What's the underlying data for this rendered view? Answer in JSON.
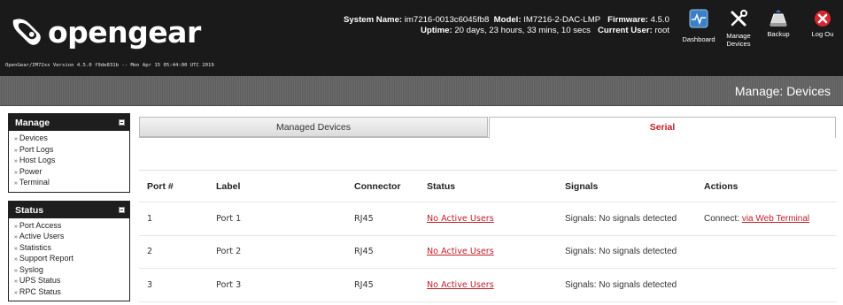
{
  "header": {
    "logo_text": "opengear",
    "version_line": "OpenGear/IM72xx Version 4.5.0 f9de831b -- Mon Apr 15 05:44:00 UTC 2019",
    "system_name_label": "System Name:",
    "system_name": "im7216-0013c6045fb8",
    "model_label": "Model:",
    "model": "IM7216-2-DAC-LMP",
    "firmware_label": "Firmware:",
    "firmware": "4.5.0",
    "uptime_label": "Uptime:",
    "uptime": "20 days, 23 hours, 33 mins, 10 secs",
    "current_user_label": "Current User:",
    "current_user": "root",
    "nav": {
      "dashboard": "Dashboard",
      "manage_devices_1": "Manage",
      "manage_devices_2": "Devices",
      "backup": "Backup",
      "logout": "Log Ou"
    }
  },
  "banner": {
    "title": "Manage: Devices"
  },
  "sidebar": {
    "manage": {
      "title": "Manage",
      "items": [
        "Devices",
        "Port Logs",
        "Host Logs",
        "Power",
        "Terminal"
      ]
    },
    "status": {
      "title": "Status",
      "items": [
        "Port Access",
        "Active Users",
        "Statistics",
        "Support Report",
        "Syslog",
        "UPS Status",
        "RPC Status"
      ]
    }
  },
  "tabs": {
    "managed": "Managed Devices",
    "serial": "Serial"
  },
  "table": {
    "headers": [
      "Port #",
      "Label",
      "Connector",
      "Status",
      "Signals",
      "Actions"
    ],
    "rows": [
      {
        "port": "1",
        "label": "Port 1",
        "connector": "RJ45",
        "status": "No Active Users",
        "signals": "Signals: No signals detected",
        "action_prefix": "Connect:",
        "action_link": "via Web Terminal"
      },
      {
        "port": "2",
        "label": "Port 2",
        "connector": "RJ45",
        "status": "No Active Users",
        "signals": "Signals: No signals detected",
        "action_prefix": "",
        "action_link": ""
      },
      {
        "port": "3",
        "label": "Port 3",
        "connector": "RJ45",
        "status": "No Active Users",
        "signals": "Signals: No signals detected",
        "action_prefix": "",
        "action_link": ""
      }
    ]
  },
  "colors": {
    "accent": "#c0202a",
    "header_bg": "#1a1a1a",
    "banner_bg": "#666666"
  }
}
